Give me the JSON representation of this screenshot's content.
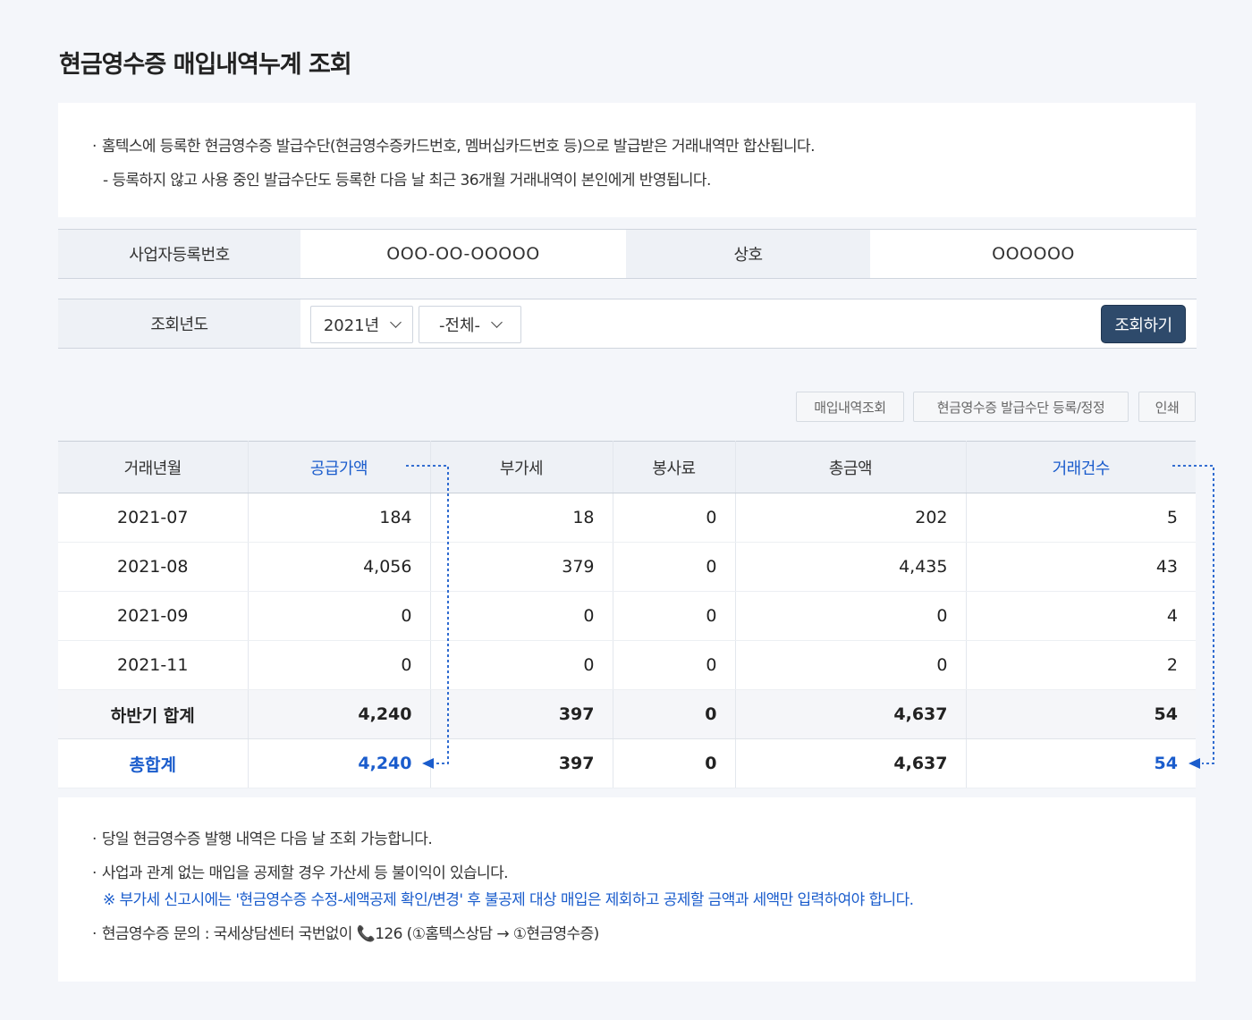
{
  "page": {
    "title": "현금영수증 매입내역누계 조회"
  },
  "notice_top": {
    "line1": "홈텍스에 등록한 현금영수증 발급수단(현금영수증카드번호, 멤버십카드번호 등)으로 발급받은 거래내역만 합산됩니다.",
    "line2": "- 등록하지 않고 사용 중인 발급수단도 등록한 다음 날 최근 36개월 거래내역이 본인에게 반영됩니다."
  },
  "business": {
    "reg_label": "사업자등록번호",
    "reg_value": "OOO-OO-OOOOO",
    "name_label": "상호",
    "name_value": "OOOOOO"
  },
  "query": {
    "year_label": "조회년도",
    "year_value": "2021년",
    "period_value": "-전체-",
    "search_button": "조회하기"
  },
  "actions": {
    "purchase_history": "매입내역조회",
    "register_method": "현금영수증 발급수단 등록/정정",
    "print": "인쇄"
  },
  "table": {
    "headers": [
      "거래년월",
      "공급가액",
      "부가세",
      "봉사료",
      "총금액",
      "거래건수"
    ],
    "rows": [
      [
        "2021-07",
        "184",
        "18",
        "0",
        "202",
        "5"
      ],
      [
        "2021-08",
        "4,056",
        "379",
        "0",
        "4,435",
        "43"
      ],
      [
        "2021-09",
        "0",
        "0",
        "0",
        "0",
        "4"
      ],
      [
        "2021-11",
        "0",
        "0",
        "0",
        "0",
        "2"
      ]
    ],
    "half_total": [
      "하반기 합계",
      "4,240",
      "397",
      "0",
      "4,637",
      "54"
    ],
    "grand_total": [
      "총합계",
      "4,240",
      "397",
      "0",
      "4,637",
      "54"
    ]
  },
  "notice_bottom": {
    "line1": "당일 현금영수증 발행 내역은 다음 날 조회 가능합니다.",
    "line2": "사업과 관계 없는 매입을 공제할 경우 가산세 등 불이익이 있습니다.",
    "line3": "※ 부가세 신고시에는 '현금영수증 수정-세액공제 확인/변경' 후 불공제 대상 매입은 제회하고 공제할 금액과 세액만 입력하여야 합니다.",
    "line4": "현금영수증 문의 : 국세상담센터 국번없이 📞126 (①홈텍스상담 → ①현금영수증)"
  },
  "colors": {
    "accent": "#1a5ccc",
    "button": "#2e4a6b",
    "background": "#f4f6fa"
  }
}
